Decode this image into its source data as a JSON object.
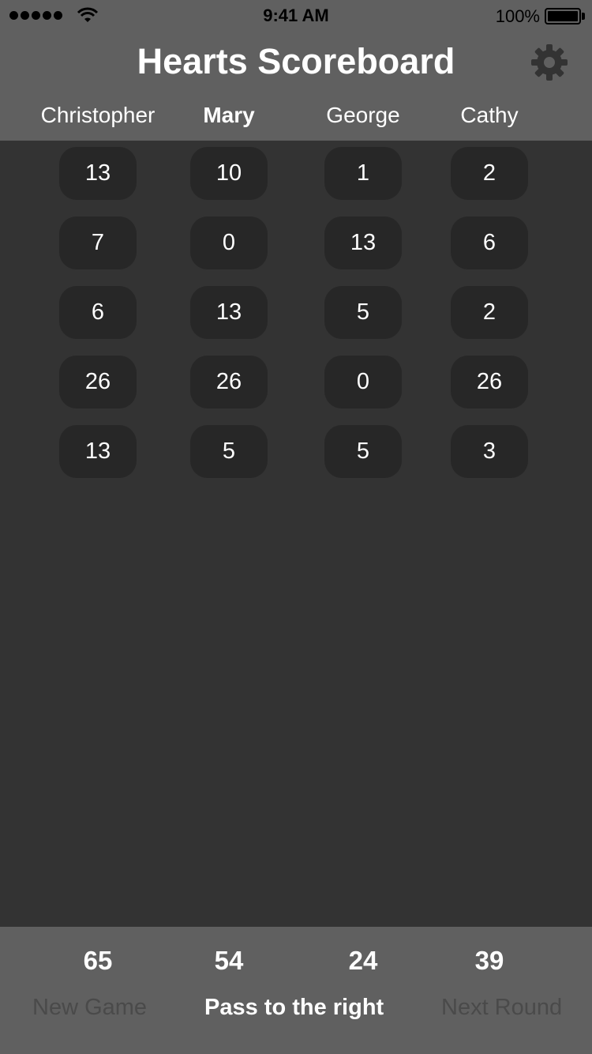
{
  "status_bar": {
    "time": "9:41 AM",
    "battery": "100%"
  },
  "header": {
    "title": "Hearts Scoreboard",
    "settings_icon": "gear-icon"
  },
  "players": [
    {
      "name": "Christopher"
    },
    {
      "name": "Mary"
    },
    {
      "name": "George"
    },
    {
      "name": "Cathy"
    }
  ],
  "rounds": [
    [
      "13",
      "10",
      "1",
      "2"
    ],
    [
      "7",
      "0",
      "13",
      "6"
    ],
    [
      "6",
      "13",
      "5",
      "2"
    ],
    [
      "26",
      "26",
      "0",
      "26"
    ],
    [
      "13",
      "5",
      "5",
      "3"
    ]
  ],
  "totals": [
    "65",
    "54",
    "24",
    "39"
  ],
  "footer": {
    "new_game": "New Game",
    "pass": "Pass to the right",
    "next_round": "Next Round"
  },
  "colors": {
    "header_bg": "#606060",
    "body_bg": "#333333",
    "cell_bg": "#272727",
    "disabled": "#4a4a4a"
  }
}
